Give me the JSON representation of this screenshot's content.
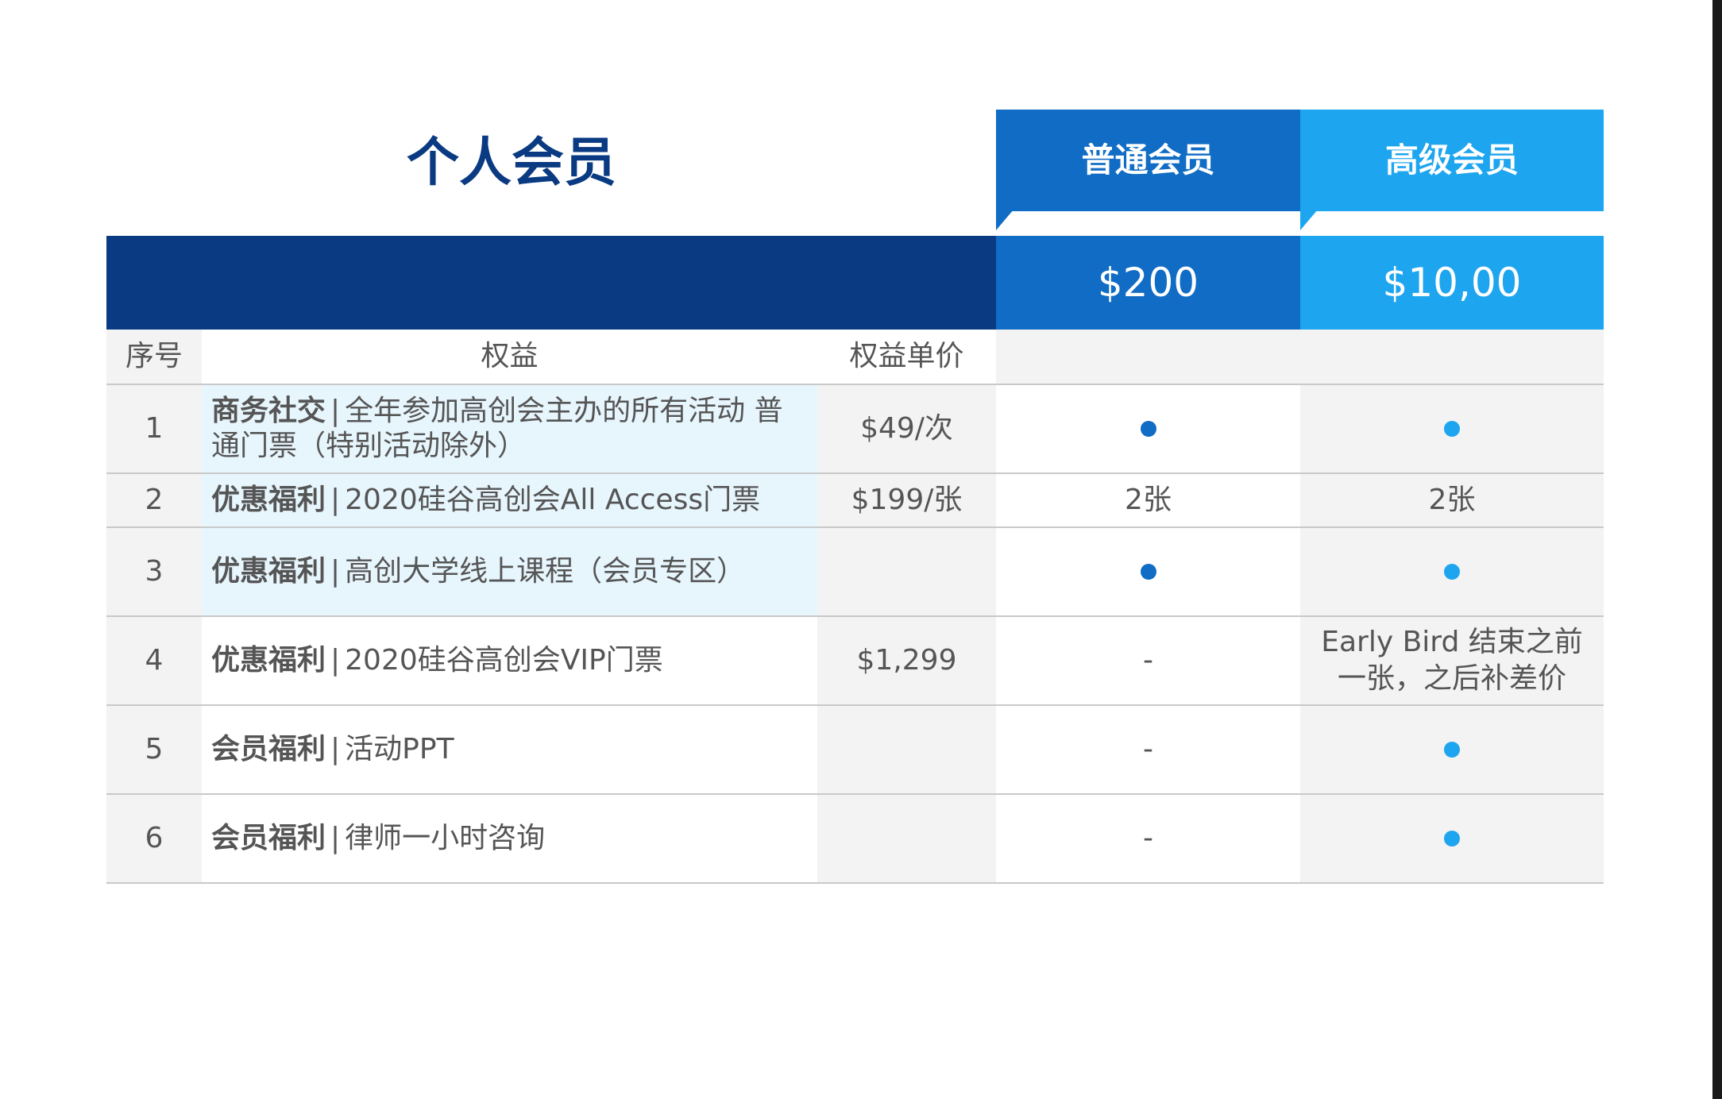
{
  "title": "个人会员",
  "tiers": [
    {
      "name": "普通会员",
      "price": "$200",
      "color": "#106cc4"
    },
    {
      "name": "高级会员",
      "price": "$10,00",
      "color": "#1ea5ef"
    }
  ],
  "header_color": "#0a3a82",
  "columns": [
    "序号",
    "权益",
    "权益单价"
  ],
  "separator": "|",
  "rows": [
    {
      "no": "1",
      "category": "商务社交",
      "desc": "全年参加高创会主办的所有活动 普通门票（特别活动除外）",
      "price": "$49/次",
      "standard": "dot-icon",
      "premium": "dot-icon"
    },
    {
      "no": "2",
      "category": "优惠福利",
      "desc": "2020硅谷高创会All Access门票",
      "price": "$199/张",
      "standard": "2张",
      "premium": "2张"
    },
    {
      "no": "3",
      "category": "优惠福利",
      "desc": "高创大学线上课程（会员专区）",
      "price": "",
      "standard": "dot-icon",
      "premium": "dot-icon"
    },
    {
      "no": "4",
      "category": "优惠福利",
      "desc": "2020硅谷高创会VIP门票",
      "price": "$1,299",
      "standard": "-",
      "premium": "Early Bird 结束之前一张，之后补差价"
    },
    {
      "no": "5",
      "category": "会员福利",
      "desc": "活动PPT",
      "price": "",
      "standard": "-",
      "premium": "dot-icon"
    },
    {
      "no": "6",
      "category": "会员福利",
      "desc": "律师一小时咨询",
      "price": "",
      "standard": "-",
      "premium": "dot-icon"
    }
  ]
}
